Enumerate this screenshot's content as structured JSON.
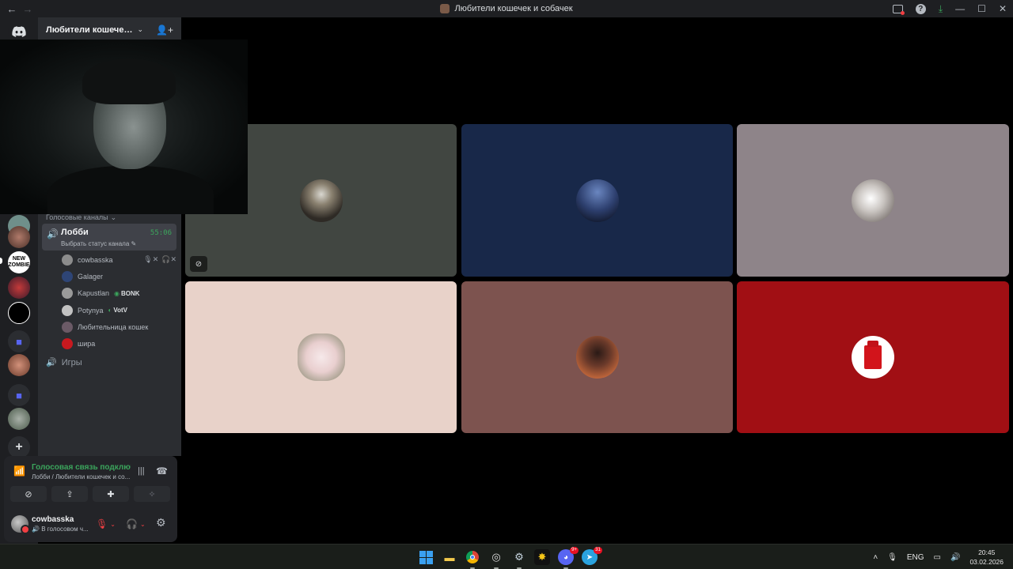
{
  "window": {
    "title": "Любители кошечек и собачек",
    "back": "←",
    "forward": "→",
    "help": "?",
    "download": "⤓",
    "minimize": "—",
    "maximize": "☐",
    "close": "✕"
  },
  "server_rail": {
    "folder_glyph": "■",
    "add_glyph": "+",
    "badge_text": "NEW ZOMBIE"
  },
  "guild": {
    "name": "Любители кошечек и с...",
    "chevron": "⌄",
    "invite_icon": "👤+"
  },
  "voice_category": {
    "label": "Голосовые каналы",
    "chevron": "⌄"
  },
  "active_channel": {
    "name": "Лобби",
    "timer": "55:06",
    "status": "Выбрать статус канала ✎",
    "icon": "🔊"
  },
  "members": [
    {
      "name": "cowbasska",
      "tag": "",
      "icons": [
        "🎙✕",
        "🎧✕"
      ],
      "color": "#8c8c8c"
    },
    {
      "name": "Galager",
      "tag": "",
      "icons": [],
      "color": "#2e4576"
    },
    {
      "name": "Kapustlan",
      "tag": "BONK",
      "tag_icon": "◉",
      "icons": [],
      "color": "#9a9a9a"
    },
    {
      "name": "Potynya",
      "tag": "VotV",
      "tag_icon": "◐",
      "icons": [],
      "color": "#c2c2c2"
    },
    {
      "name": "Любительница кошек",
      "tag": "",
      "icons": [],
      "color": "#6b5a66"
    },
    {
      "name": "шира",
      "tag": "",
      "icons": [],
      "color": "#c7191f"
    }
  ],
  "other_channel": {
    "name": "Игры",
    "icon": "🔊"
  },
  "voice_panel": {
    "title": "Голосовая связь подключ",
    "subtitle": "Лобби / Любители кошечек и со...",
    "wave_icon": "|||",
    "hangup_icon": "☎",
    "buttons": [
      "⊘",
      "⇪",
      "✚",
      "✧"
    ]
  },
  "user": {
    "name": "cowbasska",
    "status": "В голосовом ч...",
    "status_icon": "🔊",
    "mic_icon": "🎙",
    "headset_icon": "🎧",
    "chevron": "⌄",
    "gear_icon": "⚙"
  },
  "grid": {
    "cam_off_icon": "⊘",
    "tiles": [
      "tile-1",
      "tile-2",
      "tile-3",
      "tile-4",
      "tile-5",
      "tile-6"
    ]
  },
  "taskbar": {
    "discord_badge": "9+",
    "telegram_badge": "31",
    "language": "ENG",
    "time": "20:45",
    "date": "03.02.2026",
    "tray_up": "˄",
    "mic_icon": "🎙",
    "display_icon": "▭",
    "volume_icon": "🔊"
  }
}
